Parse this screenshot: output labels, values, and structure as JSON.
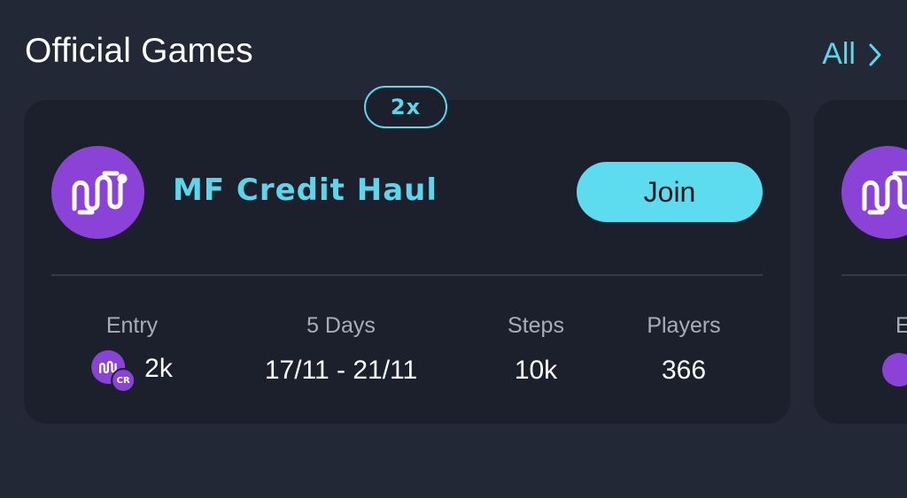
{
  "header": {
    "title": "Official Games",
    "see_all_label": "All"
  },
  "cards": [
    {
      "multiplier": "2x",
      "title": "MF Credit Haul",
      "join_label": "Join",
      "stats": {
        "entry_label": "Entry",
        "entry_value": "2k",
        "entry_currency": "CR",
        "duration_label": "5 Days",
        "duration_value": "17/11 - 21/11",
        "steps_label": "Steps",
        "steps_value": "10k",
        "players_label": "Players",
        "players_value": "366"
      }
    },
    {
      "entry_label_partial": "E"
    }
  ],
  "icons": {
    "logo": "mf-brand-icon",
    "chevron": "chevron-right-icon",
    "coin": "credit-coin-icon"
  },
  "colors": {
    "background": "#232836",
    "card": "#1b202c",
    "accent": "#5cd6ea",
    "brand_purple": "#8a43d6",
    "muted_text": "#a7adb9"
  }
}
